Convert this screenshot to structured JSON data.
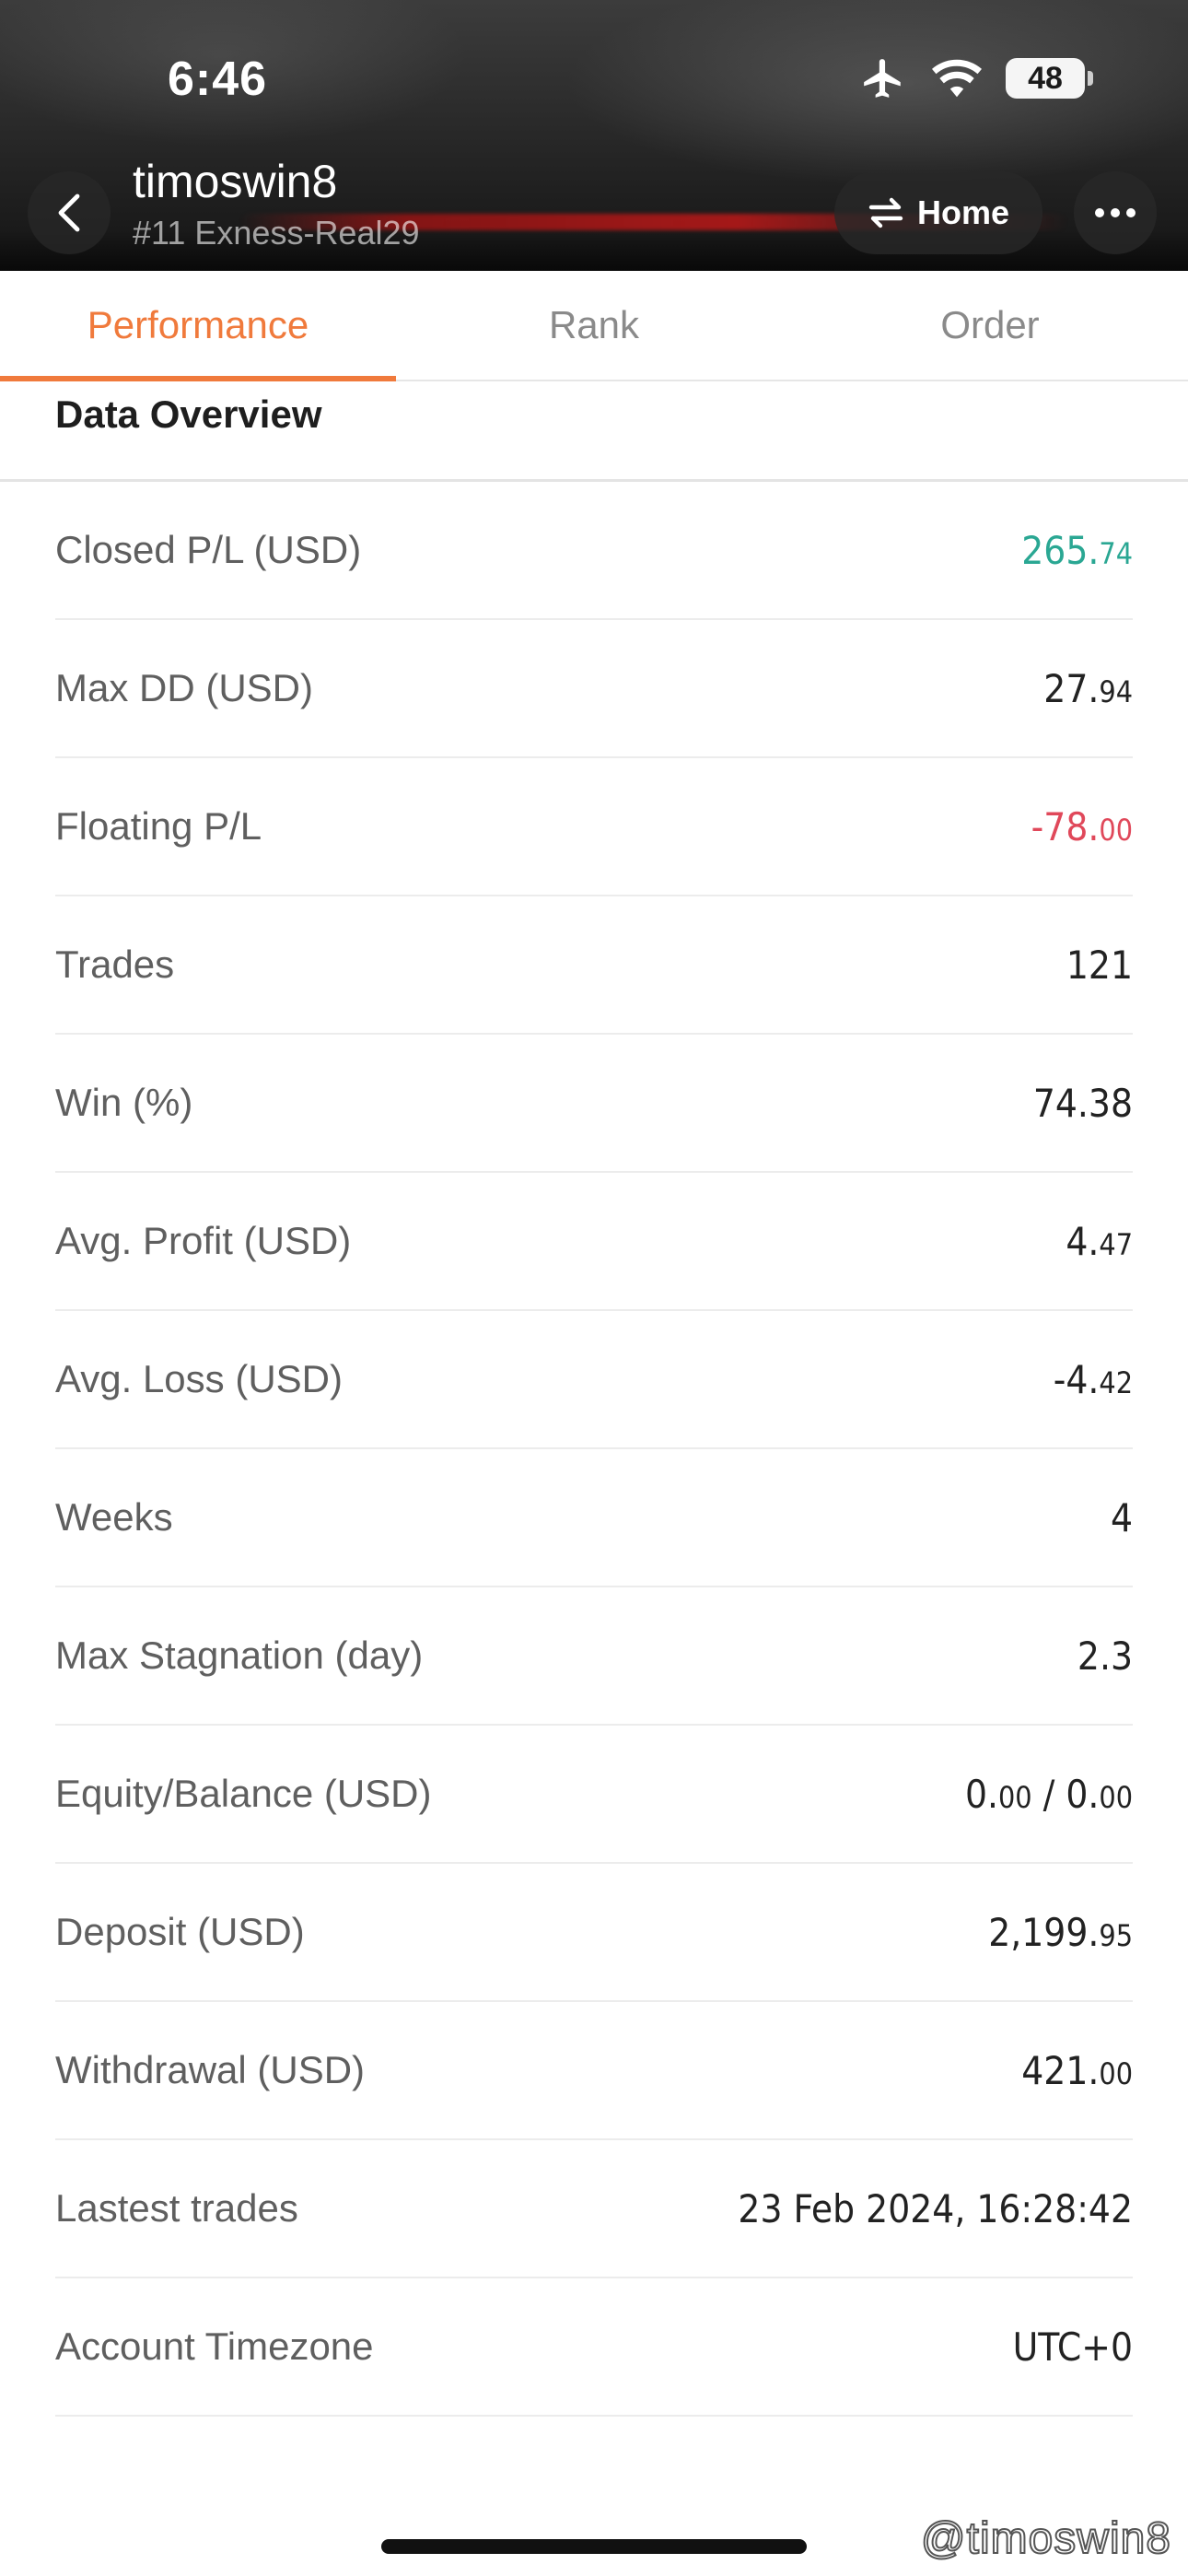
{
  "status_bar": {
    "time": "6:46",
    "battery": "48",
    "battery_level": 0.48,
    "icons": [
      "airplane-icon",
      "wifi-icon",
      "battery-icon"
    ]
  },
  "header": {
    "account_name": "timoswin8",
    "account_sub": "#11 Exness-Real29",
    "home_label": "Home"
  },
  "tabs": [
    {
      "label": "Performance",
      "active": true
    },
    {
      "label": "Rank",
      "active": false
    },
    {
      "label": "Order",
      "active": false
    }
  ],
  "section": {
    "title": "Data Overview"
  },
  "rows": [
    {
      "label": "Closed P/L (USD)",
      "int": "265.",
      "dec": "74",
      "tone": "positive"
    },
    {
      "label": "Max DD (USD)",
      "int": "27.",
      "dec": "94",
      "tone": "neutral"
    },
    {
      "label": "Floating P/L",
      "int": "-78.",
      "dec": "00",
      "tone": "negative"
    },
    {
      "label": "Trades",
      "int": "121",
      "dec": "",
      "tone": "neutral"
    },
    {
      "label": "Win (%)",
      "int": "74.38",
      "dec": "",
      "tone": "neutral"
    },
    {
      "label": "Avg. Profit (USD)",
      "int": "4.",
      "dec": "47",
      "tone": "neutral"
    },
    {
      "label": "Avg. Loss (USD)",
      "int": "-4.",
      "dec": "42",
      "tone": "neutral"
    },
    {
      "label": "Weeks",
      "int": "4",
      "dec": "",
      "tone": "neutral"
    },
    {
      "label": "Max Stagnation (day)",
      "int": "2.3",
      "dec": "",
      "tone": "neutral"
    },
    {
      "label": "Equity/Balance (USD)",
      "int": "0.",
      "dec": "00",
      "int2": " / 0.",
      "dec2": "00",
      "tone": "neutral"
    },
    {
      "label": "Deposit (USD)",
      "int": "2,199.",
      "dec": "95",
      "tone": "neutral"
    },
    {
      "label": "Withdrawal (USD)",
      "int": "421.",
      "dec": "00",
      "tone": "neutral"
    },
    {
      "label": "Lastest trades",
      "int": "23 Feb 2024, 16:28:42",
      "dec": "",
      "tone": "neutral"
    },
    {
      "label": "Account Timezone",
      "int": "UTC+0",
      "dec": "",
      "tone": "neutral"
    }
  ],
  "colors": {
    "accent": "#f07a3c",
    "positive": "#2aa793",
    "negative": "#e0485a"
  },
  "watermark": "@timoswin8"
}
